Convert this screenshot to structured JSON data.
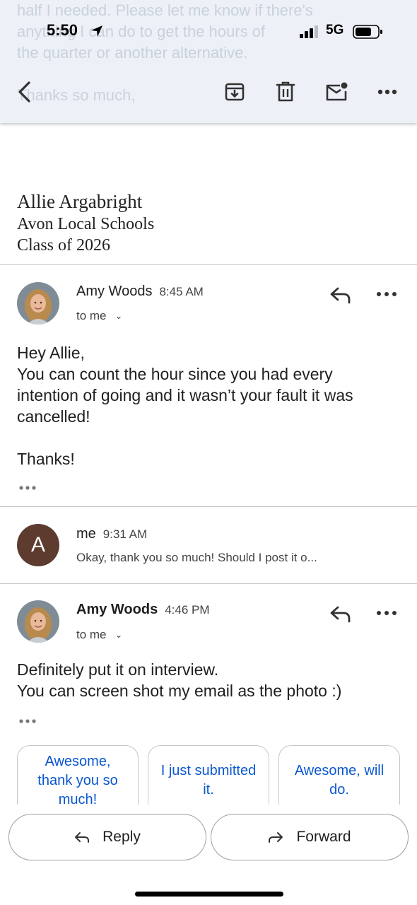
{
  "status_bar": {
    "time": "5:50",
    "network": "5G"
  },
  "background_text": "half I needed. Please let me know if there's\nanything I can do to get the hours of\nthe quarter or another alternative.\n\nThanks so much,",
  "signature": {
    "name": "Allie Argabright",
    "school": "Avon Local Schools",
    "class": "Class of 2026"
  },
  "messages": [
    {
      "sender": "Amy Woods",
      "time": "8:45 AM",
      "recipient": "to me",
      "body": "Hey Allie,\nYou can count the hour since you had every\nintention of going and it wasn’t your fault it was\ncancelled!\n\nThanks!"
    },
    {
      "sender": "me",
      "avatar_letter": "A",
      "time": "9:31 AM",
      "snippet": "Okay, thank you so much! Should I post it o..."
    },
    {
      "sender": "Amy Woods",
      "time": "4:46 PM",
      "recipient": "to me",
      "body": "Definitely put it on interview.\nYou can screen shot my email as the photo :)"
    }
  ],
  "smart_replies": [
    "Awesome, thank you so much!",
    "I just submitted it.",
    "Awesome, will do."
  ],
  "actions": {
    "reply": "Reply",
    "forward": "Forward"
  },
  "colors": {
    "toolbar_bg": "#edf1f7",
    "accent_link": "#0b57d0",
    "me_avatar": "#5d3b2e"
  },
  "icons": {
    "back": "back-arrow-icon",
    "archive": "archive-icon",
    "delete": "trash-icon",
    "unread": "mark-unread-icon",
    "more": "more-horizontal-icon",
    "reply": "reply-icon",
    "forward": "forward-icon"
  }
}
